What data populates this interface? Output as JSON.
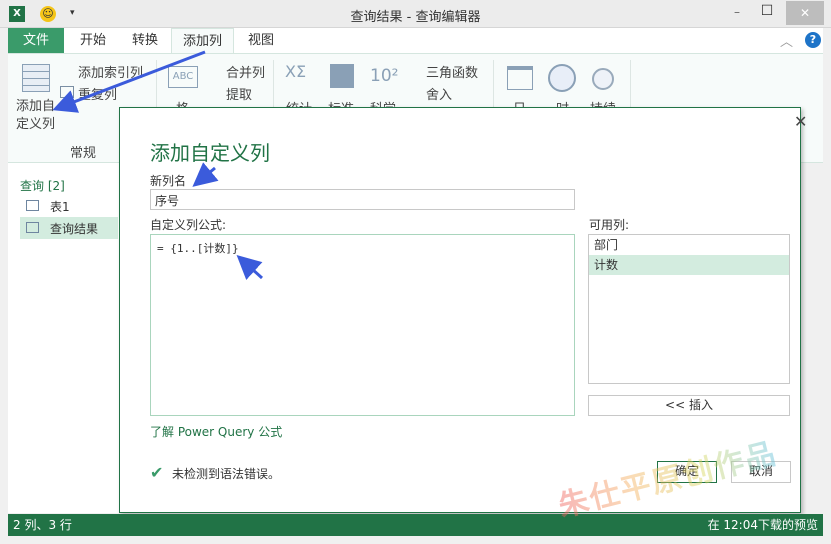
{
  "window": {
    "title": "查询结果 - 查询编辑器",
    "minimize": "–",
    "maximize": "☐",
    "close": "✕"
  },
  "tabs": [
    {
      "label": "文件"
    },
    {
      "label": "开始"
    },
    {
      "label": "转换"
    },
    {
      "label": "添加列"
    },
    {
      "label": "视图"
    }
  ],
  "ribbon": {
    "add_custom_column": "添加自\n定义列",
    "add_index_column": "添加索引列",
    "duplicate_column": "重复列",
    "group_label": "常规",
    "format": "格",
    "merge_columns": "合并列",
    "extract": "提取",
    "statistics": "统计",
    "standard": "标准",
    "scientific": "科学",
    "trig": "三角函数",
    "round": "舍入",
    "date": "日",
    "time": "时",
    "duration": "持续"
  },
  "left_pane": {
    "header": "查询 [2]",
    "items": [
      {
        "label": "表1"
      },
      {
        "label": "查询结果",
        "selected": true
      }
    ]
  },
  "dialog": {
    "title": "添加自定义列",
    "new_column_label": "新列名",
    "new_column_value": "序号",
    "formula_label": "自定义列公式:",
    "formula_value": "= {1..[计数]}",
    "available_label": "可用列:",
    "available_columns": [
      {
        "label": "部门"
      },
      {
        "label": "计数",
        "selected": true
      }
    ],
    "insert_button": "<< 插入",
    "learn_link": "了解 Power Query 公式",
    "status_message": "未检测到语法错误。",
    "ok_button": "确定",
    "cancel_button": "取消"
  },
  "statusbar": {
    "left": "2 列、3 行",
    "right": "在 12:04下载的预览"
  },
  "watermark": "朱仕平原创作品",
  "colors": {
    "accent": "#217346",
    "arrow": "#3b5bdb",
    "selected": "#d3ecdf"
  }
}
